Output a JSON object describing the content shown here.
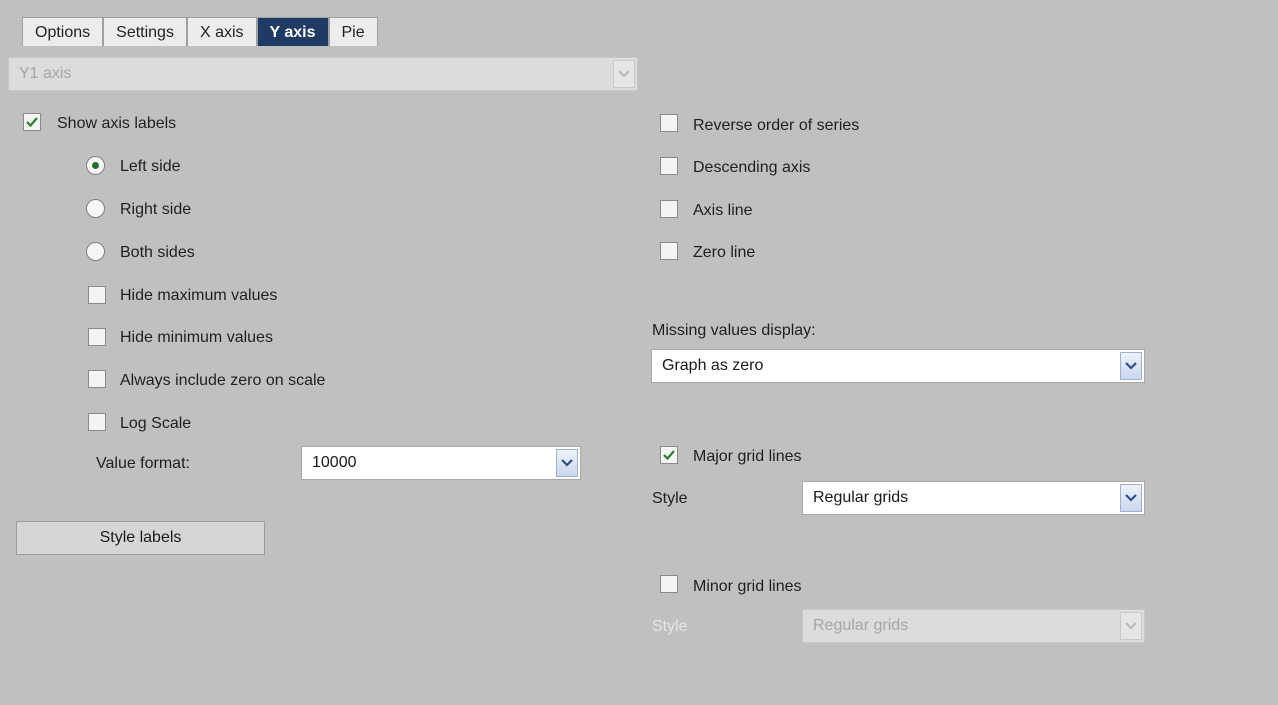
{
  "tabs": [
    "Options",
    "Settings",
    "X axis",
    "Y axis",
    "Pie"
  ],
  "active_tab": "Y axis",
  "axis_select": {
    "value": "Y1 axis"
  },
  "left": {
    "show_axis_labels": {
      "label": "Show axis labels",
      "checked": true
    },
    "sides": [
      {
        "label": "Left side",
        "selected": true
      },
      {
        "label": "Right side",
        "selected": false
      },
      {
        "label": "Both sides",
        "selected": false
      }
    ],
    "hide_max": {
      "label": "Hide maximum values",
      "checked": false
    },
    "hide_min": {
      "label": "Hide minimum values",
      "checked": false
    },
    "include_zero": {
      "label": "Always include zero on scale",
      "checked": false
    },
    "log_scale": {
      "label": "Log Scale",
      "checked": false
    },
    "value_format": {
      "label": "Value format:",
      "value": "10000"
    },
    "style_labels_button": "Style labels"
  },
  "right": {
    "reverse_series": {
      "label": "Reverse order of series",
      "checked": false
    },
    "descending_axis": {
      "label": "Descending axis",
      "checked": false
    },
    "axis_line": {
      "label": "Axis line",
      "checked": false
    },
    "zero_line": {
      "label": "Zero line",
      "checked": false
    },
    "missing_values": {
      "label": "Missing values display:",
      "value": "Graph as zero"
    },
    "major_grid": {
      "label": "Major grid lines",
      "checked": true,
      "style_label": "Style",
      "style_value": "Regular grids"
    },
    "minor_grid": {
      "label": "Minor grid lines",
      "checked": false,
      "style_label": "Style",
      "style_value": "Regular grids"
    }
  },
  "colors": {
    "background": "#c0c0c0",
    "active_tab": "#1f3a64",
    "check": "#2e7d32"
  },
  "icons": {
    "check": "check-icon",
    "dropdown": "chevron-down-icon"
  }
}
